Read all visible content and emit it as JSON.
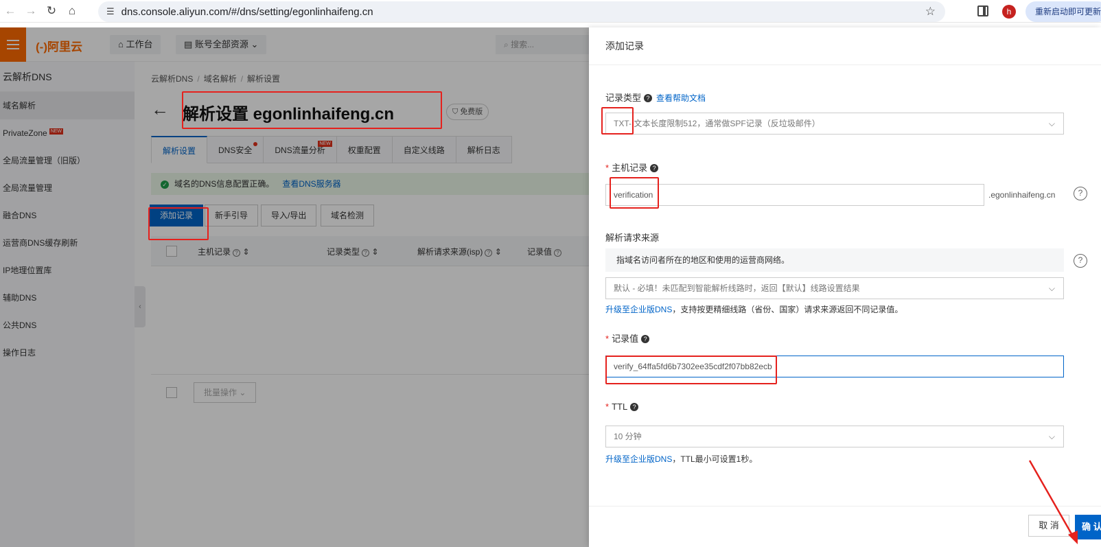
{
  "browser": {
    "url": "dns.console.aliyun.com/#/dns/setting/egonlinhaifeng.cn",
    "profile_initial": "h",
    "restart_label": "重新启动即可更新"
  },
  "console": {
    "logo": "(-)阿里云",
    "workbench": "工作台",
    "resources": "账号全部资源",
    "search_placeholder": "搜索..."
  },
  "sidebar": {
    "title": "云解析DNS",
    "items": [
      {
        "label": "域名解析"
      },
      {
        "label": "PrivateZone",
        "tag": "NEW"
      },
      {
        "label": "全局流量管理（旧版）"
      },
      {
        "label": "全局流量管理"
      },
      {
        "label": "融合DNS"
      },
      {
        "label": "运营商DNS缓存刷新"
      },
      {
        "label": "IP地理位置库"
      },
      {
        "label": "辅助DNS"
      },
      {
        "label": "公共DNS"
      },
      {
        "label": "操作日志"
      }
    ]
  },
  "main": {
    "breadcrumb": [
      "云解析DNS",
      "域名解析",
      "解析设置"
    ],
    "title": "解析设置 egonlinhaifeng.cn",
    "badge": "免费版",
    "tabs": [
      {
        "label": "解析设置"
      },
      {
        "label": "DNS安全"
      },
      {
        "label": "DNS流量分析",
        "tag": "NEW"
      },
      {
        "label": "权重配置"
      },
      {
        "label": "自定义线路"
      },
      {
        "label": "解析日志"
      }
    ],
    "alert_text": "域名的DNS信息配置正确。",
    "alert_link": "查看DNS服务器",
    "buttons": [
      "添加记录",
      "新手引导",
      "导入/导出",
      "域名检测"
    ],
    "columns": [
      "主机记录",
      "记录类型",
      "解析请求来源(isp)",
      "记录值"
    ],
    "batch_label": "批量操作"
  },
  "drawer": {
    "title": "添加记录",
    "record_type_label": "记录类型",
    "help_link": "查看帮助文档",
    "record_type_value": "TXT- 文本长度限制512，通常做SPF记录（反垃圾邮件）",
    "host_label": "主机记录",
    "host_value": "verification",
    "host_suffix": ".egonlinhaifeng.cn",
    "source_label": "解析请求来源",
    "source_note": "指域名访问者所在的地区和使用的运营商网络。",
    "source_value": "默认 - 必填！未匹配到智能解析线路时，返回【默认】线路设置结果",
    "upgrade_link": "升级至企业版DNS",
    "upgrade_hint_1": "，支持按更精细线路（省份、国家）请求来源返回不同记录值。",
    "value_label": "记录值",
    "value_value": "verify_64ffa5fd6b7302ee35cdf2f07bb82ecb",
    "ttl_label": "TTL",
    "ttl_value": "10 分钟",
    "upgrade_hint_2": "，TTL最小可设置1秒。",
    "cancel_label": "取 消",
    "confirm_label": "确 认"
  },
  "colors": {
    "brand_orange": "#ff6a00",
    "primary_blue": "#0064c8",
    "annotation_red": "#e5211d"
  }
}
